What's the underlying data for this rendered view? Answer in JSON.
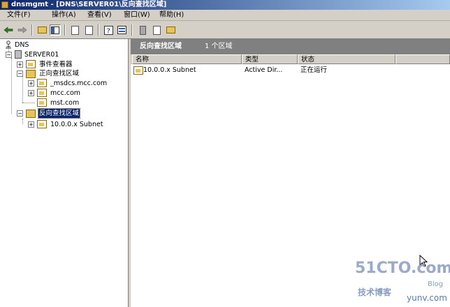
{
  "window": {
    "title": "dnsmgmt - [DNS\\SERVER01\\反向查找区域]"
  },
  "menu": [
    {
      "label": "文件(F)"
    },
    {
      "label": "操作(A)"
    },
    {
      "label": "查看(V)"
    },
    {
      "label": "窗口(W)"
    },
    {
      "label": "帮助(H)"
    }
  ],
  "tree": {
    "root": "DNS",
    "server": "SERVER01",
    "event_viewer": "事件查看器",
    "forward_zones": "正向查找区域",
    "forward_children": [
      "_msdcs.mcc.com",
      "mcc.com",
      "mst.com"
    ],
    "reverse_zones": "反向查找区域",
    "reverse_children": [
      "10.0.0.x Subnet"
    ]
  },
  "right": {
    "title": "反向查找区域",
    "count": "1 个区域",
    "columns": [
      "名称",
      "类型",
      "状态"
    ],
    "rows": [
      {
        "name": "10.0.0.x Subnet",
        "type": "Active Dir...",
        "status": "正在运行"
      }
    ]
  },
  "watermark": {
    "main": "51CTO.com",
    "sub": "技术博客",
    "url": "yunv.com",
    "blog": "Blog"
  }
}
